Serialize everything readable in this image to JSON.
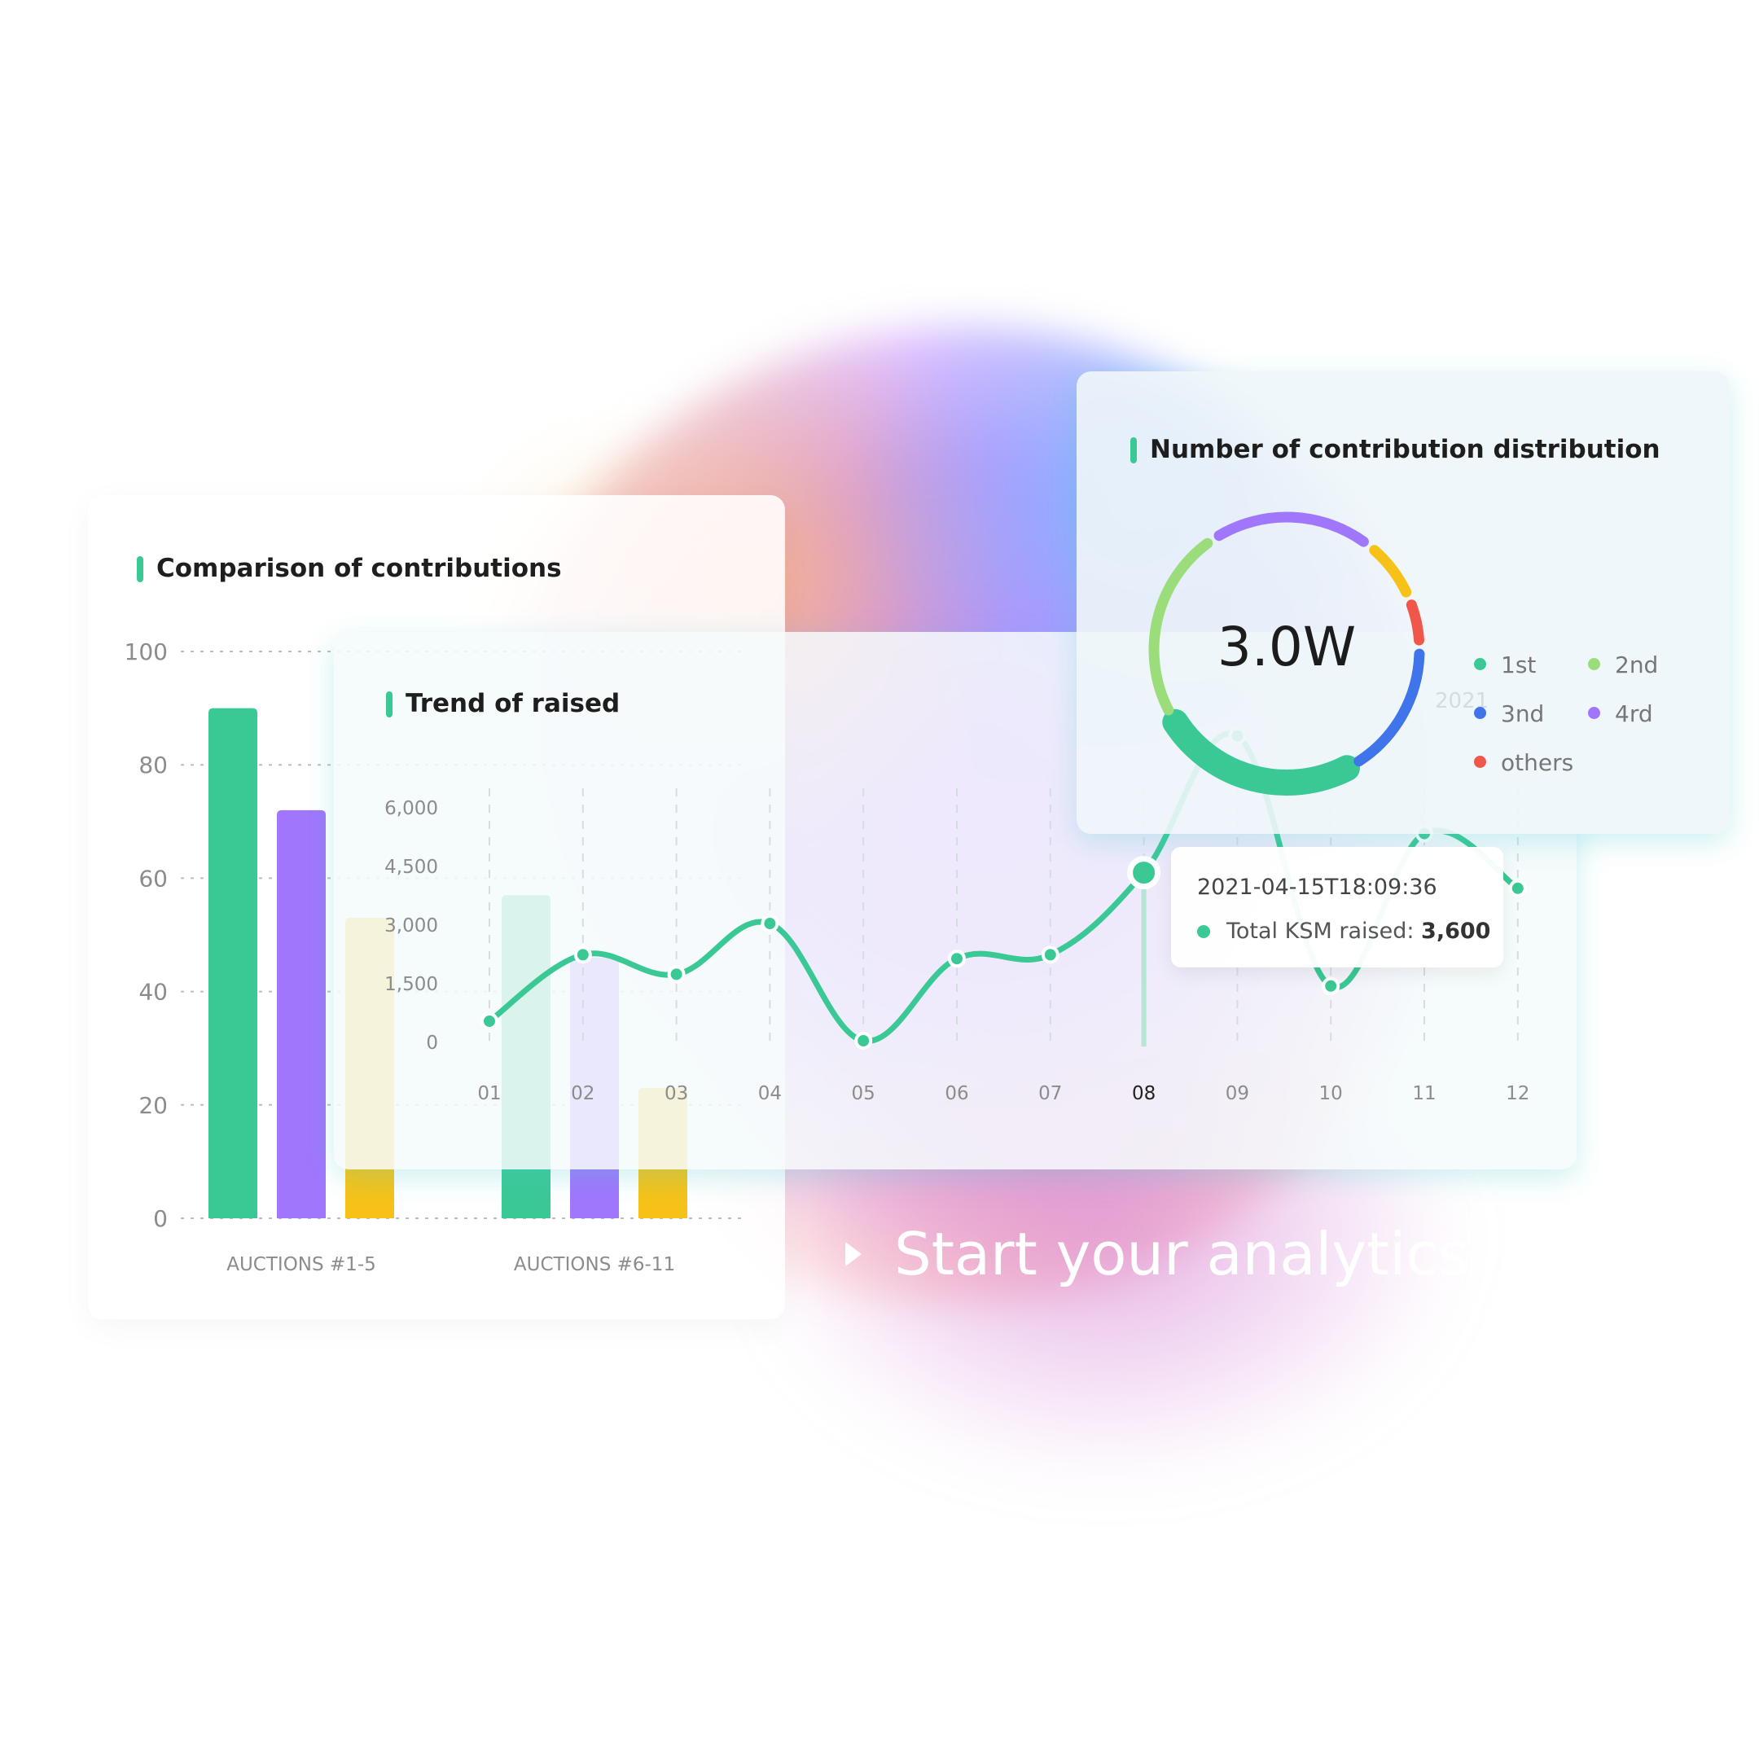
{
  "colors": {
    "green": "#3ac995",
    "purple": "#a076fc",
    "yellow": "#f6c218",
    "blue": "#3f74ea",
    "light_green": "#9bdd7a",
    "red": "#f0564a",
    "tooltip_dot": "#3ac995"
  },
  "chart_data": [
    {
      "type": "bar",
      "title": "Comparison of contributions",
      "categories": [
        "AUCTIONS #1-5",
        "AUCTIONS #6-11"
      ],
      "series": [
        {
          "color": "#3ac995",
          "values": [
            90,
            57
          ]
        },
        {
          "color": "#a076fc",
          "values": [
            72,
            46
          ]
        },
        {
          "color": "#f6c218",
          "values": [
            53,
            23
          ]
        }
      ],
      "y_ticks": [
        "0",
        "20",
        "40",
        "60",
        "80",
        "100"
      ],
      "ylim": [
        0,
        100
      ],
      "grid": "horizontal dotted"
    },
    {
      "type": "line",
      "title": "Trend of raised",
      "x": [
        "01",
        "02",
        "03",
        "04",
        "05",
        "06",
        "07",
        "08",
        "09",
        "10",
        "11",
        "12"
      ],
      "values": [
        500,
        2200,
        1700,
        3000,
        0,
        2100,
        2200,
        4300,
        7800,
        1400,
        5300,
        3900
      ],
      "y_ticks": [
        "0",
        "1,500",
        "3,000",
        "4,500",
        "6,000"
      ],
      "ylim": [
        0,
        6000
      ],
      "highlight_index": 7,
      "tooltip": {
        "time": "2021-04-15T18:09:36",
        "label": "Total KSM raised:",
        "value": "3,600"
      }
    },
    {
      "type": "pie",
      "title": "Number of contribution distribution",
      "center_label": "3.0W",
      "slices": [
        {
          "name": "1st",
          "value": 25,
          "color": "#3ac995"
        },
        {
          "name": "2nd",
          "value": 24,
          "color": "#9bdd7a"
        },
        {
          "name": "4rd",
          "value": 20,
          "color": "#a076fc"
        },
        {
          "name": "yellow",
          "value": 8,
          "color": "#f6c218"
        },
        {
          "name": "others",
          "value": 6,
          "color": "#f0564a"
        },
        {
          "name": "3nd",
          "value": 17,
          "color": "#3f74ea"
        }
      ],
      "legend": [
        {
          "label": "1st",
          "color": "#3ac995"
        },
        {
          "label": "2nd",
          "color": "#9bdd7a"
        },
        {
          "label": "3nd",
          "color": "#3f74ea"
        },
        {
          "label": "4rd",
          "color": "#a076fc"
        },
        {
          "label": "others",
          "color": "#f0564a"
        }
      ]
    }
  ],
  "cta": {
    "label": "Start your analytics"
  },
  "ghost_year": "2021"
}
